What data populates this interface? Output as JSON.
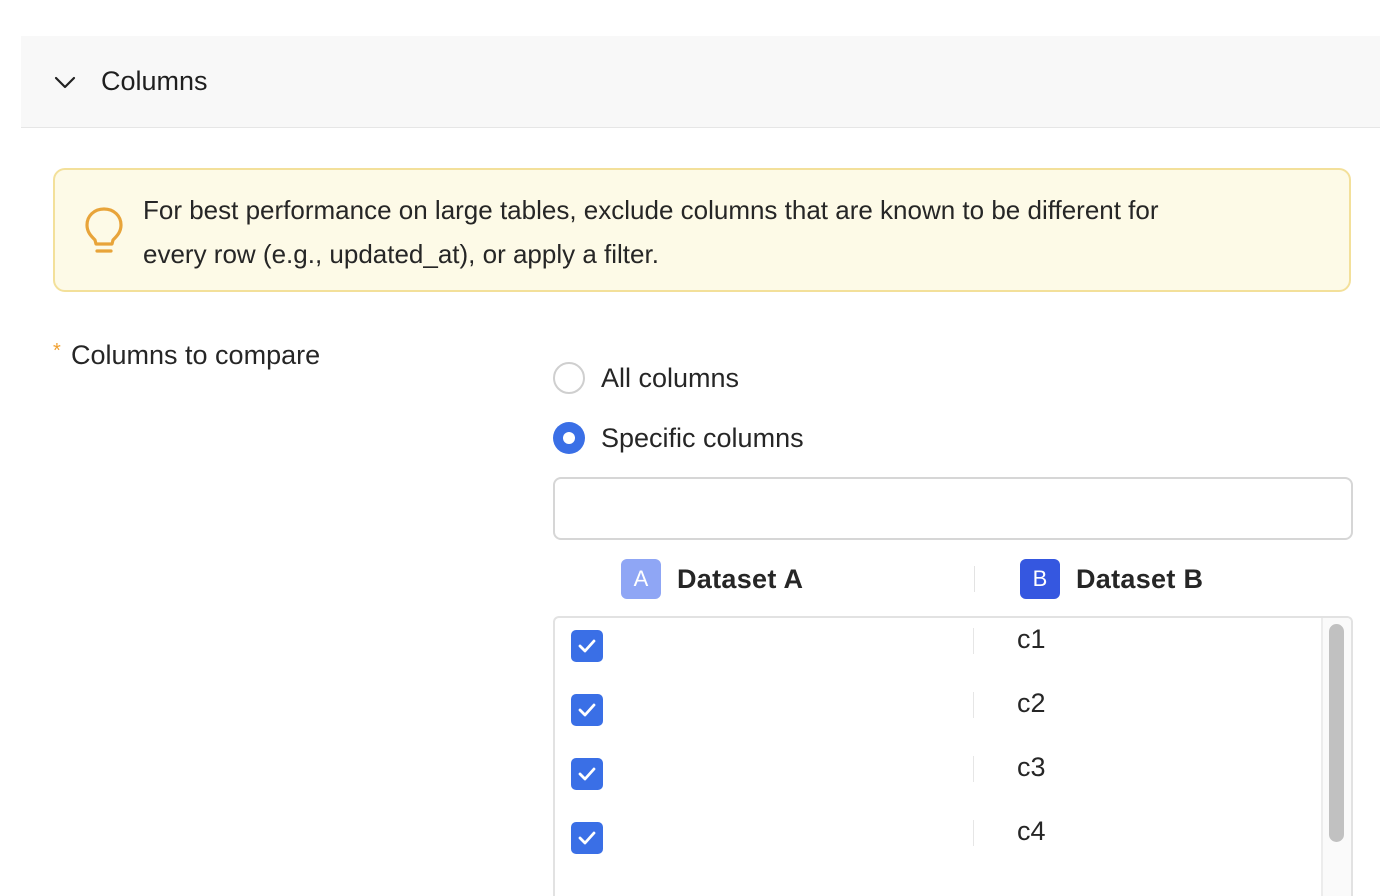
{
  "section": {
    "title": "Columns"
  },
  "tip": {
    "line1": "For best performance on large tables, exclude columns that are known to be different for",
    "line2": "every row (e.g., updated_at), or apply a filter."
  },
  "field": {
    "required_mark": "*",
    "label": "Columns to compare",
    "options": [
      {
        "label": "All columns",
        "selected": false
      },
      {
        "label": "Specific columns",
        "selected": true
      }
    ],
    "search": {
      "value": "",
      "placeholder": ""
    }
  },
  "datasets": {
    "a": {
      "badge": "A",
      "name": "Dataset A",
      "color": "#8fa6f5"
    },
    "b": {
      "badge": "B",
      "name": "Dataset B",
      "color": "#3557e0"
    }
  },
  "rows": [
    {
      "checked": true,
      "name": "c1"
    },
    {
      "checked": true,
      "name": "c2"
    },
    {
      "checked": true,
      "name": "c3"
    },
    {
      "checked": true,
      "name": "c4"
    }
  ],
  "colors": {
    "accent": "#3a6fe6",
    "tip_bg": "#fdfae7",
    "tip_border": "#f3e09a",
    "tip_icon": "#e8a43a"
  }
}
